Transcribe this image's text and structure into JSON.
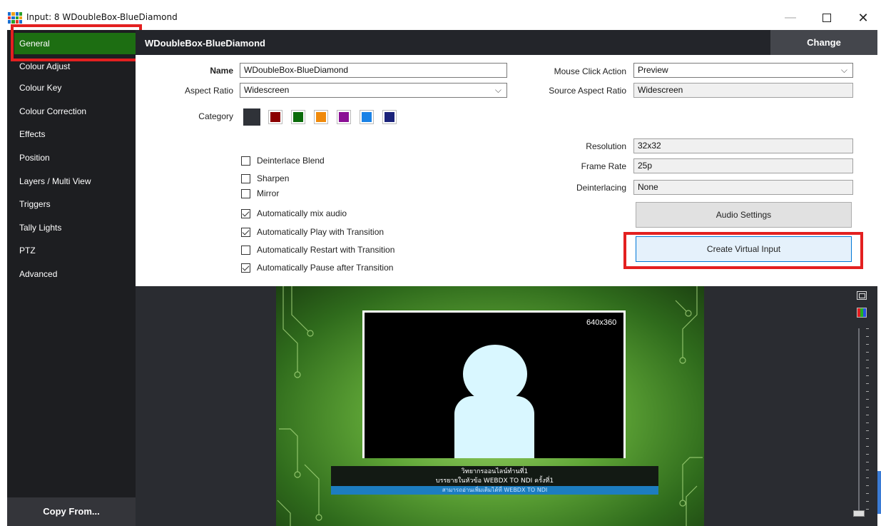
{
  "window": {
    "title": "Input: 8 WDoubleBox-BlueDiamond",
    "controls": {
      "minimize": "—",
      "maximize": "☐",
      "close": "✕"
    }
  },
  "sidebar": {
    "items": [
      {
        "label": "General",
        "active": true
      },
      {
        "label": "Colour Adjust"
      },
      {
        "label": "Colour Key"
      },
      {
        "label": "Colour Correction"
      },
      {
        "label": "Effects"
      },
      {
        "label": "Position"
      },
      {
        "label": "Layers / Multi View"
      },
      {
        "label": "Triggers"
      },
      {
        "label": "Tally Lights"
      },
      {
        "label": "PTZ"
      },
      {
        "label": "Advanced"
      }
    ],
    "copy_from": "Copy From..."
  },
  "header": {
    "title": "WDoubleBox-BlueDiamond",
    "change_label": "Change"
  },
  "general": {
    "name_label": "Name",
    "name_value": "WDoubleBox-BlueDiamond",
    "aspect_label": "Aspect Ratio",
    "aspect_value": "Widescreen",
    "category_label": "Category",
    "category_colors": [
      "#2f3238",
      "#8b0000",
      "#0b6b0b",
      "#f08a0c",
      "#8b1095",
      "#1b82e6",
      "#1b237a"
    ],
    "mouse_click_label": "Mouse Click Action",
    "mouse_click_value": "Preview",
    "source_aspect_label": "Source Aspect Ratio",
    "source_aspect_value": "Widescreen",
    "resolution_label": "Resolution",
    "resolution_value": "32x32",
    "frame_rate_label": "Frame Rate",
    "frame_rate_value": "25p",
    "deinterlacing_label": "Deinterlacing",
    "deinterlacing_value": "None",
    "audio_settings_label": "Audio Settings",
    "create_virtual_input_label": "Create Virtual Input",
    "checkboxes": [
      {
        "label": "Deinterlace Blend",
        "checked": false
      },
      {
        "label": "Sharpen",
        "checked": false
      },
      {
        "label": "Mirror",
        "checked": false
      },
      {
        "label": "Automatically mix audio",
        "checked": true
      },
      {
        "label": "Automatically Play with Transition",
        "checked": true
      },
      {
        "label": "Automatically Restart with Transition",
        "checked": false
      },
      {
        "label": "Automatically Pause after Transition",
        "checked": true
      }
    ]
  },
  "preview": {
    "resolution_overlay": "640x360",
    "ticker_line1": "วิทยากรออนไลน์ทำนที่1",
    "ticker_line2": "บรรยายในหัวข้อ WEBDX TO NDI ครั้งที่1",
    "ticker_line3": "สามารถอ่านเพิ่มเติมได้ที่ WEBDX TO NDI"
  }
}
